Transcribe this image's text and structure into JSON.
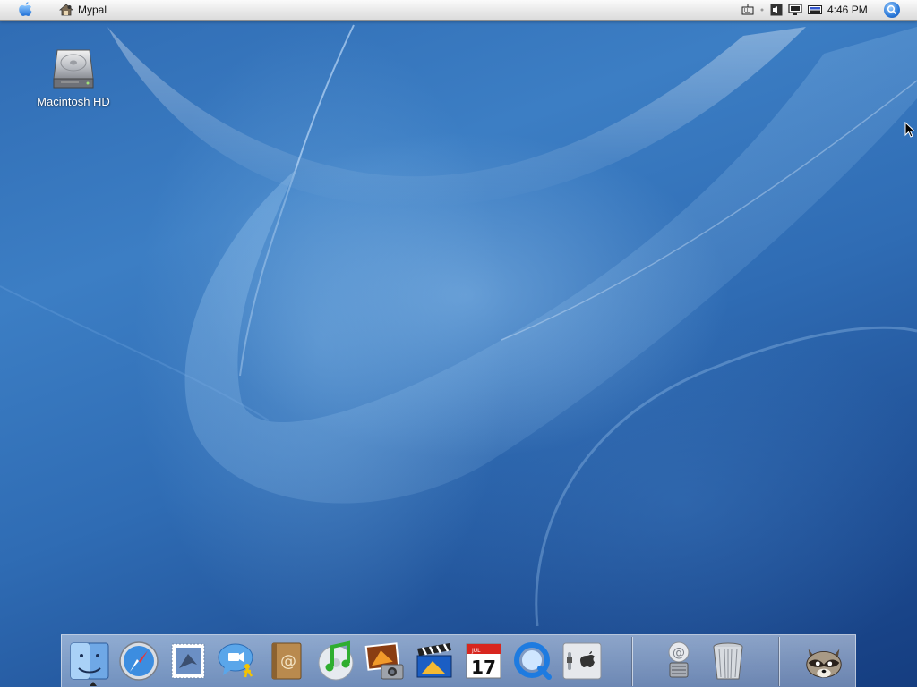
{
  "menubar": {
    "apple_icon": "apple-icon",
    "app_name": "Mypal",
    "clock": "4:46 PM",
    "status_icons": [
      "keyboard-icon",
      "volume-icon",
      "display-icon",
      "battery-icon"
    ],
    "spotlight_icon": "spotlight-search-icon"
  },
  "desktop": {
    "icons": [
      {
        "label": "Macintosh HD",
        "icon": "hard-drive-icon"
      }
    ]
  },
  "dock": {
    "apps": [
      "Finder",
      "Safari",
      "Mail",
      "iChat",
      "Address Book",
      "iTunes",
      "iPhoto",
      "iMovie",
      "iCal",
      "QuickTime",
      "System Preferences"
    ],
    "calendar_month": "JUL",
    "calendar_day": "17",
    "documents": [
      "Mail Download Folder",
      "Trash"
    ],
    "running": [
      "Mypal"
    ]
  },
  "colors": {
    "wallpaper_base": "#2f6bb3",
    "wallpaper_dark": "#153d80",
    "menubar": "#e7e7e7",
    "accent": "#2a78d8"
  }
}
